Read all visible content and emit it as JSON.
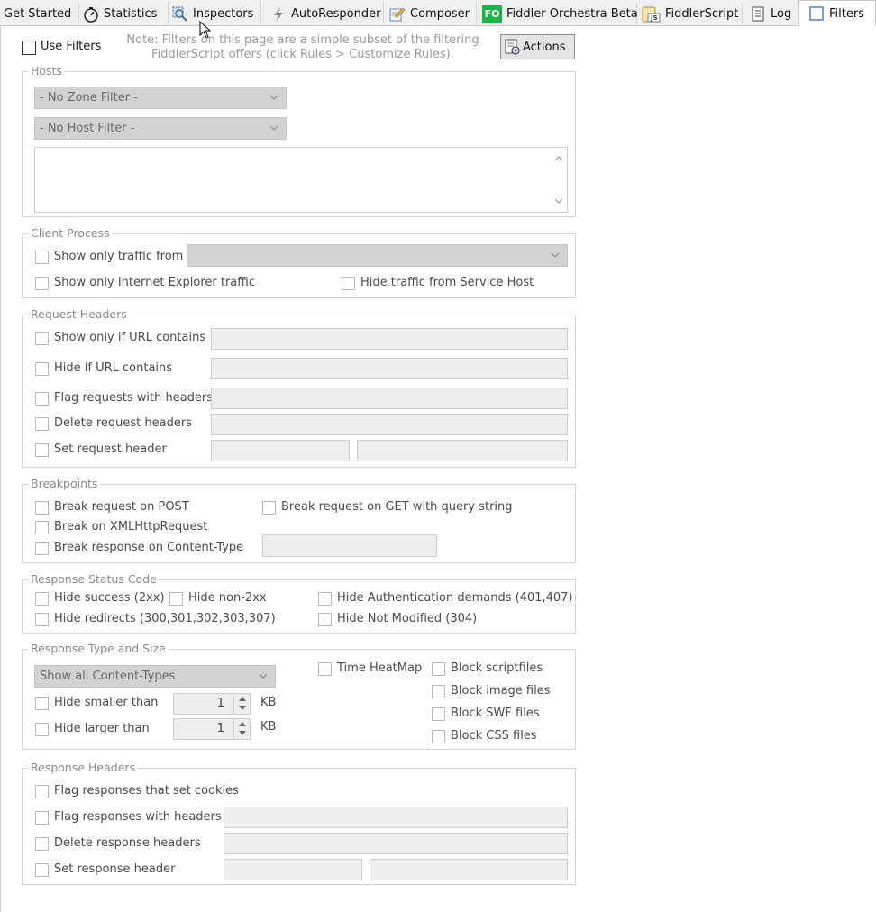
{
  "tabs": [
    {
      "label": "Get Started",
      "icon": "none"
    },
    {
      "label": "Statistics",
      "icon": "stopwatch-icon"
    },
    {
      "label": "Inspectors",
      "icon": "magnifier-icon"
    },
    {
      "label": "AutoResponder",
      "icon": "lightning-icon"
    },
    {
      "label": "Composer",
      "icon": "pencil-icon"
    },
    {
      "label": "Fiddler Orchestra Beta",
      "icon": "fo-badge-icon",
      "badge": "FO"
    },
    {
      "label": "FiddlerScript",
      "icon": "js-script-icon",
      "badge": "JS"
    },
    {
      "label": "Log",
      "icon": "log-icon"
    },
    {
      "label": "Filters",
      "icon": "checkbox-icon"
    }
  ],
  "active_tab": "Filters",
  "top": {
    "use_filters": "Use Filters",
    "note_line1": "Note: Filters on this page are a simple subset of the filtering",
    "note_line2": "FiddlerScript offers (click Rules > Customize Rules).",
    "actions": "Actions"
  },
  "hosts": {
    "legend": "Hosts",
    "zone_filter": "- No Zone Filter -",
    "host_filter": "- No Host Filter -"
  },
  "client_process": {
    "legend": "Client Process",
    "show_only_traffic_from": "Show only traffic from",
    "show_only_ie": "Show only Internet Explorer traffic",
    "hide_service_host": "Hide traffic from Service Host"
  },
  "request_headers": {
    "legend": "Request Headers",
    "show_only_url": "Show only if URL contains",
    "hide_url": "Hide if URL contains",
    "flag_requests": "Flag requests with headers",
    "delete_request_headers": "Delete request headers",
    "set_request_header": "Set request header"
  },
  "breakpoints": {
    "legend": "Breakpoints",
    "break_post": "Break request on POST",
    "break_get": "Break request on GET with query string",
    "break_xhr": "Break on XMLHttpRequest",
    "break_content_type": "Break response on Content-Type"
  },
  "status_code": {
    "legend": "Response Status Code",
    "hide_success": "Hide success (2xx)",
    "hide_non2xx": "Hide non-2xx",
    "hide_auth": "Hide Authentication demands (401,407)",
    "hide_redirects": "Hide redirects (300,301,302,303,307)",
    "hide_not_modified": "Hide Not Modified (304)"
  },
  "type_size": {
    "legend": "Response Type and Size",
    "content_types": "Show all Content-Types",
    "time_heatmap": "Time HeatMap",
    "block_script": "Block scriptfiles",
    "block_image": "Block image files",
    "block_swf": "Block SWF files",
    "block_css": "Block CSS files",
    "hide_smaller": "Hide smaller than",
    "hide_larger": "Hide larger than",
    "smaller_value": "1",
    "larger_value": "1",
    "unit": "KB"
  },
  "response_headers": {
    "legend": "Response Headers",
    "flag_cookies": "Flag responses that set cookies",
    "flag_headers": "Flag responses with headers",
    "delete_headers": "Delete response headers",
    "set_header": "Set response header"
  }
}
